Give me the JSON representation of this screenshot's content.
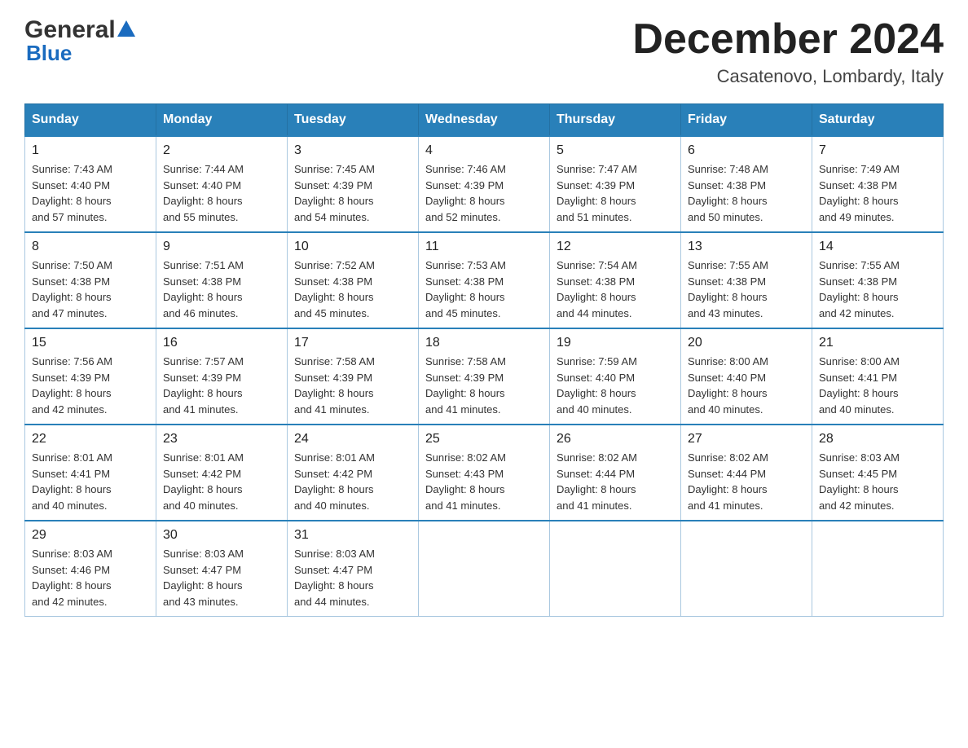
{
  "logo": {
    "general_text": "General",
    "blue_text": "Blue"
  },
  "title": "December 2024",
  "subtitle": "Casatenovo, Lombardy, Italy",
  "days_of_week": [
    "Sunday",
    "Monday",
    "Tuesday",
    "Wednesday",
    "Thursday",
    "Friday",
    "Saturday"
  ],
  "weeks": [
    [
      {
        "day": 1,
        "sunrise": "7:43 AM",
        "sunset": "4:40 PM",
        "daylight": "8 hours and 57 minutes."
      },
      {
        "day": 2,
        "sunrise": "7:44 AM",
        "sunset": "4:40 PM",
        "daylight": "8 hours and 55 minutes."
      },
      {
        "day": 3,
        "sunrise": "7:45 AM",
        "sunset": "4:39 PM",
        "daylight": "8 hours and 54 minutes."
      },
      {
        "day": 4,
        "sunrise": "7:46 AM",
        "sunset": "4:39 PM",
        "daylight": "8 hours and 52 minutes."
      },
      {
        "day": 5,
        "sunrise": "7:47 AM",
        "sunset": "4:39 PM",
        "daylight": "8 hours and 51 minutes."
      },
      {
        "day": 6,
        "sunrise": "7:48 AM",
        "sunset": "4:38 PM",
        "daylight": "8 hours and 50 minutes."
      },
      {
        "day": 7,
        "sunrise": "7:49 AM",
        "sunset": "4:38 PM",
        "daylight": "8 hours and 49 minutes."
      }
    ],
    [
      {
        "day": 8,
        "sunrise": "7:50 AM",
        "sunset": "4:38 PM",
        "daylight": "8 hours and 47 minutes."
      },
      {
        "day": 9,
        "sunrise": "7:51 AM",
        "sunset": "4:38 PM",
        "daylight": "8 hours and 46 minutes."
      },
      {
        "day": 10,
        "sunrise": "7:52 AM",
        "sunset": "4:38 PM",
        "daylight": "8 hours and 45 minutes."
      },
      {
        "day": 11,
        "sunrise": "7:53 AM",
        "sunset": "4:38 PM",
        "daylight": "8 hours and 45 minutes."
      },
      {
        "day": 12,
        "sunrise": "7:54 AM",
        "sunset": "4:38 PM",
        "daylight": "8 hours and 44 minutes."
      },
      {
        "day": 13,
        "sunrise": "7:55 AM",
        "sunset": "4:38 PM",
        "daylight": "8 hours and 43 minutes."
      },
      {
        "day": 14,
        "sunrise": "7:55 AM",
        "sunset": "4:38 PM",
        "daylight": "8 hours and 42 minutes."
      }
    ],
    [
      {
        "day": 15,
        "sunrise": "7:56 AM",
        "sunset": "4:39 PM",
        "daylight": "8 hours and 42 minutes."
      },
      {
        "day": 16,
        "sunrise": "7:57 AM",
        "sunset": "4:39 PM",
        "daylight": "8 hours and 41 minutes."
      },
      {
        "day": 17,
        "sunrise": "7:58 AM",
        "sunset": "4:39 PM",
        "daylight": "8 hours and 41 minutes."
      },
      {
        "day": 18,
        "sunrise": "7:58 AM",
        "sunset": "4:39 PM",
        "daylight": "8 hours and 41 minutes."
      },
      {
        "day": 19,
        "sunrise": "7:59 AM",
        "sunset": "4:40 PM",
        "daylight": "8 hours and 40 minutes."
      },
      {
        "day": 20,
        "sunrise": "8:00 AM",
        "sunset": "4:40 PM",
        "daylight": "8 hours and 40 minutes."
      },
      {
        "day": 21,
        "sunrise": "8:00 AM",
        "sunset": "4:41 PM",
        "daylight": "8 hours and 40 minutes."
      }
    ],
    [
      {
        "day": 22,
        "sunrise": "8:01 AM",
        "sunset": "4:41 PM",
        "daylight": "8 hours and 40 minutes."
      },
      {
        "day": 23,
        "sunrise": "8:01 AM",
        "sunset": "4:42 PM",
        "daylight": "8 hours and 40 minutes."
      },
      {
        "day": 24,
        "sunrise": "8:01 AM",
        "sunset": "4:42 PM",
        "daylight": "8 hours and 40 minutes."
      },
      {
        "day": 25,
        "sunrise": "8:02 AM",
        "sunset": "4:43 PM",
        "daylight": "8 hours and 41 minutes."
      },
      {
        "day": 26,
        "sunrise": "8:02 AM",
        "sunset": "4:44 PM",
        "daylight": "8 hours and 41 minutes."
      },
      {
        "day": 27,
        "sunrise": "8:02 AM",
        "sunset": "4:44 PM",
        "daylight": "8 hours and 41 minutes."
      },
      {
        "day": 28,
        "sunrise": "8:03 AM",
        "sunset": "4:45 PM",
        "daylight": "8 hours and 42 minutes."
      }
    ],
    [
      {
        "day": 29,
        "sunrise": "8:03 AM",
        "sunset": "4:46 PM",
        "daylight": "8 hours and 42 minutes."
      },
      {
        "day": 30,
        "sunrise": "8:03 AM",
        "sunset": "4:47 PM",
        "daylight": "8 hours and 43 minutes."
      },
      {
        "day": 31,
        "sunrise": "8:03 AM",
        "sunset": "4:47 PM",
        "daylight": "8 hours and 44 minutes."
      },
      null,
      null,
      null,
      null
    ]
  ],
  "labels": {
    "sunrise": "Sunrise:",
    "sunset": "Sunset:",
    "daylight": "Daylight:"
  },
  "colors": {
    "header_bg": "#2980b9",
    "header_border": "#2471a3",
    "row_border": "#2980b9",
    "cell_border": "#aac8e0"
  }
}
